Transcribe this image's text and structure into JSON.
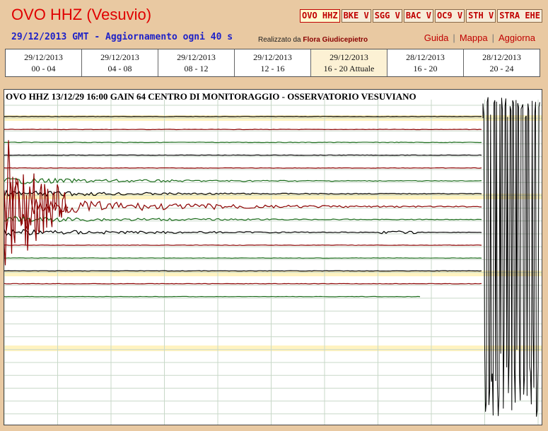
{
  "header": {
    "title": "OVO HHZ (Vesuvio)",
    "subtitle": "29/12/2013 GMT - Aggiornamento ogni 40 s",
    "credit_prefix": "Realizzato da",
    "credit_name": "Flora Giudicepietro"
  },
  "stations": [
    {
      "label": "OVO HHZ",
      "active": true
    },
    {
      "label": "BKE V",
      "active": false
    },
    {
      "label": "SGG V",
      "active": false
    },
    {
      "label": "BAC V",
      "active": false
    },
    {
      "label": "OC9 V",
      "active": false
    },
    {
      "label": "STH V",
      "active": false
    },
    {
      "label": "STRA EHE",
      "active": false
    }
  ],
  "links": {
    "guide": "Guida",
    "map": "Mappa",
    "refresh": "Aggiorna"
  },
  "time_tabs": [
    {
      "date": "29/12/2013",
      "range": "00 - 04",
      "active": false
    },
    {
      "date": "29/12/2013",
      "range": "04 - 08",
      "active": false
    },
    {
      "date": "29/12/2013",
      "range": "08 - 12",
      "active": false
    },
    {
      "date": "29/12/2013",
      "range": "12 - 16",
      "active": false
    },
    {
      "date": "29/12/2013",
      "range": "16 - 20 Attuale",
      "active": true
    },
    {
      "date": "28/12/2013",
      "range": "16 - 20",
      "active": false
    },
    {
      "date": "28/12/2013",
      "range": "20 - 24",
      "active": false
    }
  ],
  "plot": {
    "header": "OVO HHZ 13/12/29 16:00 GAIN  64  CENTRO DI MONITORAGGIO - OSSERVATORIO VESUVIANO",
    "trace_colors": [
      "#000000",
      "#8b0000",
      "#1a6b1a"
    ],
    "grid_color": "#c8d8c8",
    "highlight_color": "#fff3c0"
  }
}
